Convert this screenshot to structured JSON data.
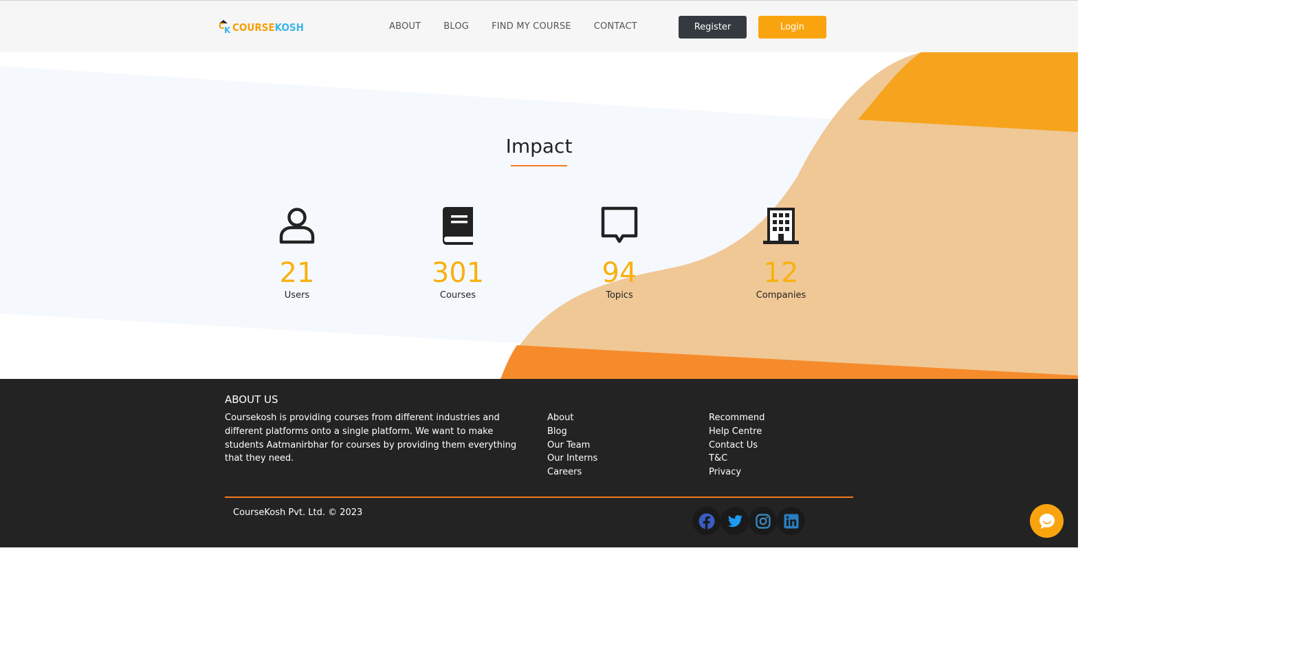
{
  "header": {
    "logo": {
      "course": "COURSE",
      "kosh": "KOSH",
      "mark_c": "C",
      "mark_k": "K"
    },
    "nav": [
      "ABOUT",
      "BLOG",
      "FIND MY COURSE",
      "CONTACT"
    ],
    "register_label": "Register",
    "login_label": "Login"
  },
  "impact": {
    "title": "Impact",
    "stats": [
      {
        "icon": "user-icon",
        "value": "21",
        "label": "Users"
      },
      {
        "icon": "book-icon",
        "value": "301",
        "label": "Courses"
      },
      {
        "icon": "chat-bubble-icon",
        "value": "94",
        "label": "Topics"
      },
      {
        "icon": "building-icon",
        "value": "12",
        "label": "Companies"
      }
    ]
  },
  "footer": {
    "about_title": "ABOUT US",
    "about_text": "Coursekosh is providing courses from different industries and different platforms onto a single platform. We want to make students Aatmanirbhar for courses by providing them everything that they need.",
    "links_col1": [
      "About",
      "Blog",
      "Our Team",
      "Our Interns",
      "Careers"
    ],
    "links_col2": [
      "Recommend",
      "Help Centre",
      "Contact Us",
      "T&C",
      "Privacy"
    ],
    "copyright": "CourseKosh Pvt. Ltd. © 2023",
    "socials": [
      "facebook-icon",
      "twitter-icon",
      "instagram-icon",
      "linkedin-icon"
    ]
  },
  "colors": {
    "accent_orange": "#f9a40f",
    "deep_orange": "#f37a1f",
    "number_yellow": "#f9b10f",
    "dark_button": "#343a40",
    "footer_bg": "#232323"
  }
}
